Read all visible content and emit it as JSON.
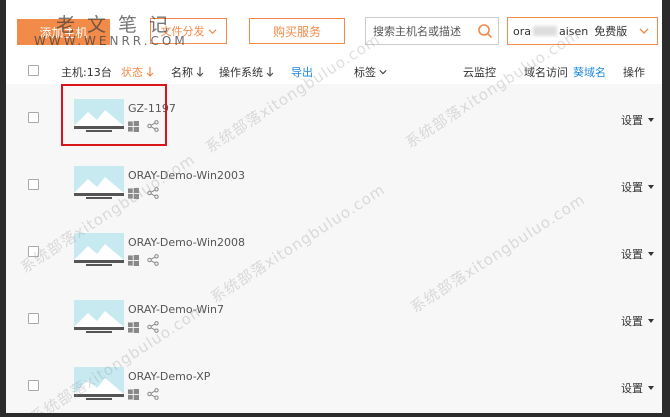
{
  "toolbar": {
    "add_host_label": "添加主机",
    "file_distribute_label": "文件分发",
    "buy_service_label": "购买服务",
    "search_placeholder": "搜索主机名或描述",
    "account_prefix": "ora",
    "account_suffix": "aisen",
    "account_plan": "免费版"
  },
  "watermark": {
    "site_cn": "老文笔记",
    "site_en": "WWW.WENRR.COM",
    "diagonal_text": "系统部落xitongbuluo.com"
  },
  "table": {
    "header": {
      "host_count": "主机:13台",
      "status": "状态",
      "name": "名称",
      "os": "操作系统",
      "export": "导出",
      "tags": "标签",
      "cloud_monitor": "云监控",
      "domain_access": "域名访问",
      "get_domain": "葵域名",
      "actions": "操作"
    },
    "rows": [
      {
        "name": "GZ-1197",
        "action": "设置"
      },
      {
        "name": "ORAY-Demo-Win2003",
        "action": "设置"
      },
      {
        "name": "ORAY-Demo-Win2008",
        "action": "设置"
      },
      {
        "name": "ORAY-Demo-Win7",
        "action": "设置"
      },
      {
        "name": "ORAY-Demo-XP",
        "action": "设置"
      }
    ]
  },
  "colors": {
    "accent": "#f28b4a",
    "link": "#1e88e5",
    "highlight": "#d9151b"
  }
}
